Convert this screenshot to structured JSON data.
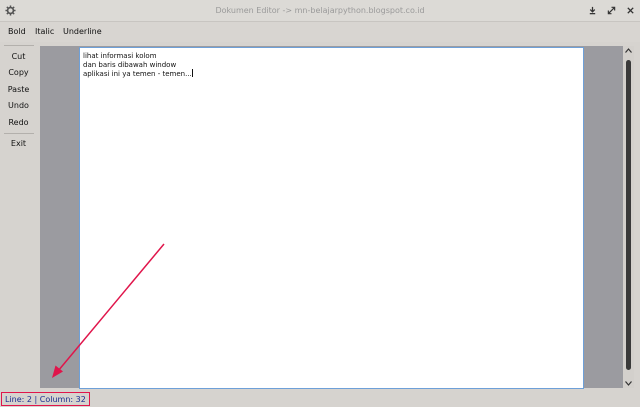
{
  "window": {
    "title": "Dokumen Editor -> mn-belajarpython.blogspot.co.id"
  },
  "menubar": {
    "items": [
      "Bold",
      "Italic",
      "Underline"
    ]
  },
  "sidebar": {
    "items": [
      "Cut",
      "Copy",
      "Paste",
      "Undo",
      "Redo",
      "Exit"
    ]
  },
  "editor": {
    "lines": [
      "lihat informasi kolom",
      "dan baris dibawah window",
      "aplikasi ini ya temen - temen..."
    ]
  },
  "status": {
    "text": "Line: 2 | Column: 32"
  },
  "colors": {
    "annotation_red": "#e0154b",
    "status_text": "#1b2d8f",
    "editor_border": "#6ea0d8"
  }
}
